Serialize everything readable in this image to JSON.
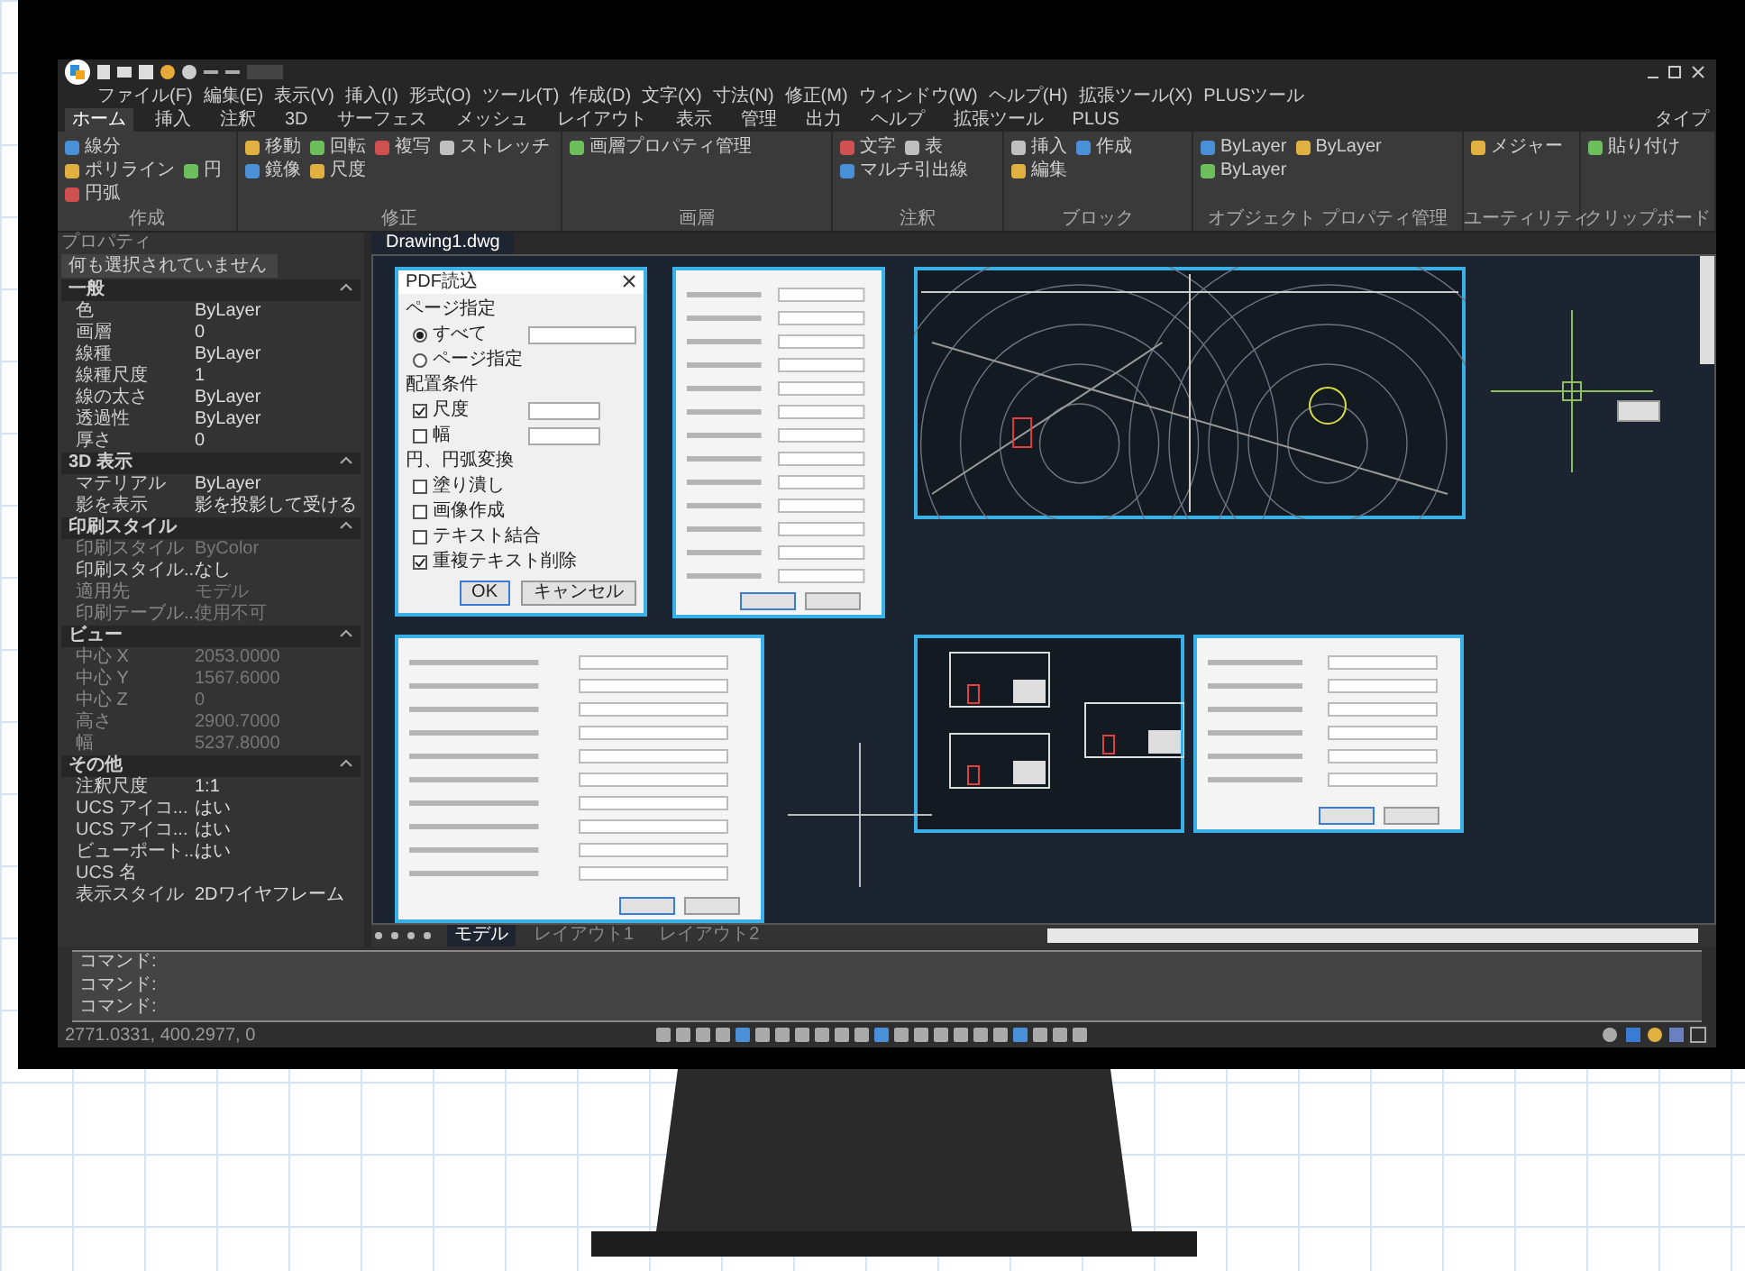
{
  "menu": [
    "ファイル(F)",
    "編集(E)",
    "表示(V)",
    "挿入(I)",
    "形式(O)",
    "ツール(T)",
    "作成(D)",
    "文字(X)",
    "寸法(N)",
    "修正(M)",
    "ウィンドウ(W)",
    "ヘルプ(H)",
    "拡張ツール(X)",
    "PLUSツール"
  ],
  "ribbon_tabs": [
    {
      "label": "ホーム",
      "selected": true
    },
    {
      "label": "挿入",
      "selected": false
    },
    {
      "label": "注釈",
      "selected": false
    },
    {
      "label": "3D",
      "selected": false
    },
    {
      "label": "サーフェス",
      "selected": false
    },
    {
      "label": "メッシュ",
      "selected": false
    },
    {
      "label": "レイアウト",
      "selected": false
    },
    {
      "label": "表示",
      "selected": false
    },
    {
      "label": "管理",
      "selected": false
    },
    {
      "label": "出力",
      "selected": false
    },
    {
      "label": "ヘルプ",
      "selected": false
    },
    {
      "label": "拡張ツール",
      "selected": false
    },
    {
      "label": "PLUS",
      "selected": false
    }
  ],
  "ribbon_right": "タイプ",
  "ribbon_groups": [
    {
      "label": "作成",
      "buttons": [
        "線分",
        "ポリライン",
        "円",
        "円弧"
      ]
    },
    {
      "label": "修正",
      "buttons": [
        "移動",
        "回転",
        "複写",
        "ストレッチ",
        "鏡像",
        "尺度"
      ]
    },
    {
      "label": "画層",
      "buttons": [
        "画層プロパティ管理"
      ]
    },
    {
      "label": "注釈",
      "buttons": [
        "文字",
        "表",
        "マルチ引出線"
      ]
    },
    {
      "label": "ブロック",
      "buttons": [
        "挿入",
        "作成",
        "編集"
      ]
    },
    {
      "label": "オブジェクト プロパティ管理",
      "buttons": [
        "ByLayer",
        "ByLayer",
        "ByLayer"
      ]
    },
    {
      "label": "ユーティリティ",
      "buttons": [
        "メジャー"
      ]
    },
    {
      "label": "クリップボード",
      "buttons": [
        "貼り付け"
      ]
    }
  ],
  "properties": {
    "title": "プロパティ",
    "selection": "何も選択されていません",
    "sections": [
      {
        "label": "一般",
        "expanded": true,
        "rows": [
          {
            "name": "色",
            "value": "ByLayer",
            "disabled": false
          },
          {
            "name": "画層",
            "value": "0",
            "disabled": false
          },
          {
            "name": "線種",
            "value": "ByLayer",
            "disabled": false
          },
          {
            "name": "線種尺度",
            "value": "1",
            "disabled": false
          },
          {
            "name": "線の太さ",
            "value": "ByLayer",
            "disabled": false
          },
          {
            "name": "透過性",
            "value": "ByLayer",
            "disabled": false
          },
          {
            "name": "厚さ",
            "value": "0",
            "disabled": false
          }
        ]
      },
      {
        "label": "3D 表示",
        "expanded": true,
        "rows": [
          {
            "name": "マテリアル",
            "value": "ByLayer",
            "disabled": false
          },
          {
            "name": "影を表示",
            "value": "影を投影して受ける",
            "disabled": false
          }
        ]
      },
      {
        "label": "印刷スタイル",
        "expanded": true,
        "rows": [
          {
            "name": "印刷スタイル",
            "value": "ByColor",
            "disabled": true
          },
          {
            "name": "印刷スタイル...",
            "value": "なし",
            "disabled": false
          },
          {
            "name": "適用先",
            "value": "モデル",
            "disabled": true
          },
          {
            "name": "印刷テーブル...",
            "value": "使用不可",
            "disabled": true
          }
        ]
      },
      {
        "label": "ビュー",
        "expanded": true,
        "rows": [
          {
            "name": "中心 X",
            "value": "2053.0000",
            "disabled": true
          },
          {
            "name": "中心 Y",
            "value": "1567.6000",
            "disabled": true
          },
          {
            "name": "中心 Z",
            "value": "0",
            "disabled": true
          },
          {
            "name": "高さ",
            "value": "2900.7000",
            "disabled": true
          },
          {
            "name": "幅",
            "value": "5237.8000",
            "disabled": true
          }
        ]
      },
      {
        "label": "その他",
        "expanded": true,
        "rows": [
          {
            "name": "注釈尺度",
            "value": "1:1",
            "disabled": false
          },
          {
            "name": "UCS アイコ...",
            "value": "はい",
            "disabled": false
          },
          {
            "name": "UCS アイコ...",
            "value": "はい",
            "disabled": false
          },
          {
            "name": "ビューポート...",
            "value": "はい",
            "disabled": false
          },
          {
            "name": "UCS 名",
            "value": "",
            "disabled": false
          },
          {
            "name": "表示スタイル",
            "value": "2Dワイヤフレーム",
            "disabled": false
          }
        ]
      }
    ]
  },
  "document_tab": "Drawing1.dwg",
  "pdf_dialog": {
    "title": "PDF読込",
    "page_group": "ページ指定",
    "radios": [
      {
        "label": "すべて",
        "selected": true
      },
      {
        "label": "ページ指定",
        "selected": false
      }
    ],
    "layout_group": "配置条件",
    "scale_rows": [
      {
        "label": "尺度",
        "checked": true
      },
      {
        "label": "幅",
        "checked": false
      }
    ],
    "arc_group": "円、円弧変換",
    "checks": [
      {
        "label": "塗り潰し",
        "checked": false
      },
      {
        "label": "画像作成",
        "checked": false
      },
      {
        "label": "テキスト結合",
        "checked": false
      },
      {
        "label": "重複テキスト削除",
        "checked": true
      }
    ],
    "buttons": [
      "OK",
      "キャンセル"
    ]
  },
  "layout_tabs": [
    {
      "label": "モデル",
      "selected": true
    },
    {
      "label": "レイアウト1",
      "selected": false
    },
    {
      "label": "レイアウト2",
      "selected": false
    }
  ],
  "command_lines": [
    "コマンド:",
    "コマンド:",
    "コマンド:"
  ],
  "status": {
    "coords": "2771.0331, 400.2977, 0"
  }
}
